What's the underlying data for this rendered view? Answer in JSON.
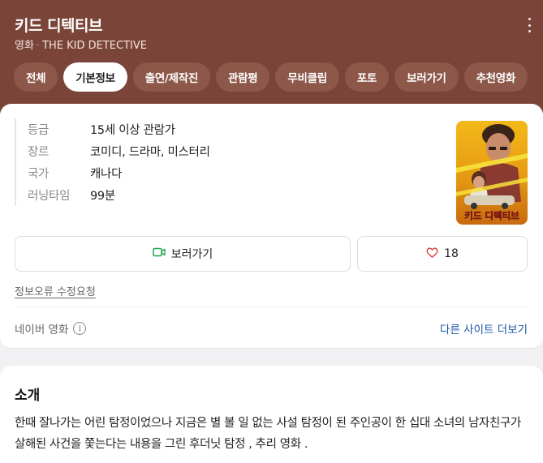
{
  "header": {
    "title": "키드 디텍티브",
    "subtitle_prefix": "영화",
    "subtitle_sep": "·",
    "subtitle_en": "THE KID DETECTIVE"
  },
  "tabs": [
    {
      "label": "전체",
      "active": false
    },
    {
      "label": "기본정보",
      "active": true
    },
    {
      "label": "출연/제작진",
      "active": false
    },
    {
      "label": "관람평",
      "active": false
    },
    {
      "label": "무비클립",
      "active": false
    },
    {
      "label": "포토",
      "active": false
    },
    {
      "label": "보러가기",
      "active": false
    },
    {
      "label": "추천영화",
      "active": false
    }
  ],
  "info": {
    "rating_key": "등급",
    "rating_val": "15세 이상 관람가",
    "genre_key": "장르",
    "genre_val": "코미디, 드라마, 미스터리",
    "country_key": "국가",
    "country_val": "캐나다",
    "runtime_key": "러닝타임",
    "runtime_val": "99분"
  },
  "poster": {
    "title_text": "키드 디텍티브"
  },
  "actions": {
    "watch_label": "보러가기",
    "like_count": "18"
  },
  "footer": {
    "report_link": "정보오류 수정요청",
    "source_label": "네이버 영화",
    "more_sites": "다른 사이트 더보기"
  },
  "intro": {
    "heading": "소개",
    "text": "한때 잘나가는 어린 탐정이었으나 지금은 별 볼 일 없는 사설 탐정이 된 주인공이 한 십대 소녀의 남자친구가 살해된 사건을 쫓는다는 내용을 그린 후더닛 탐정 , 추리 영화 ."
  },
  "colors": {
    "header_bg": "#7a4538",
    "tab_bg": "#8d5749",
    "link_blue": "#1e55a8",
    "watch_green": "#1fa84a",
    "heart_red": "#e33c3c"
  },
  "icons": [
    "more-vertical-icon",
    "video-camera-icon",
    "heart-icon",
    "info-icon"
  ]
}
